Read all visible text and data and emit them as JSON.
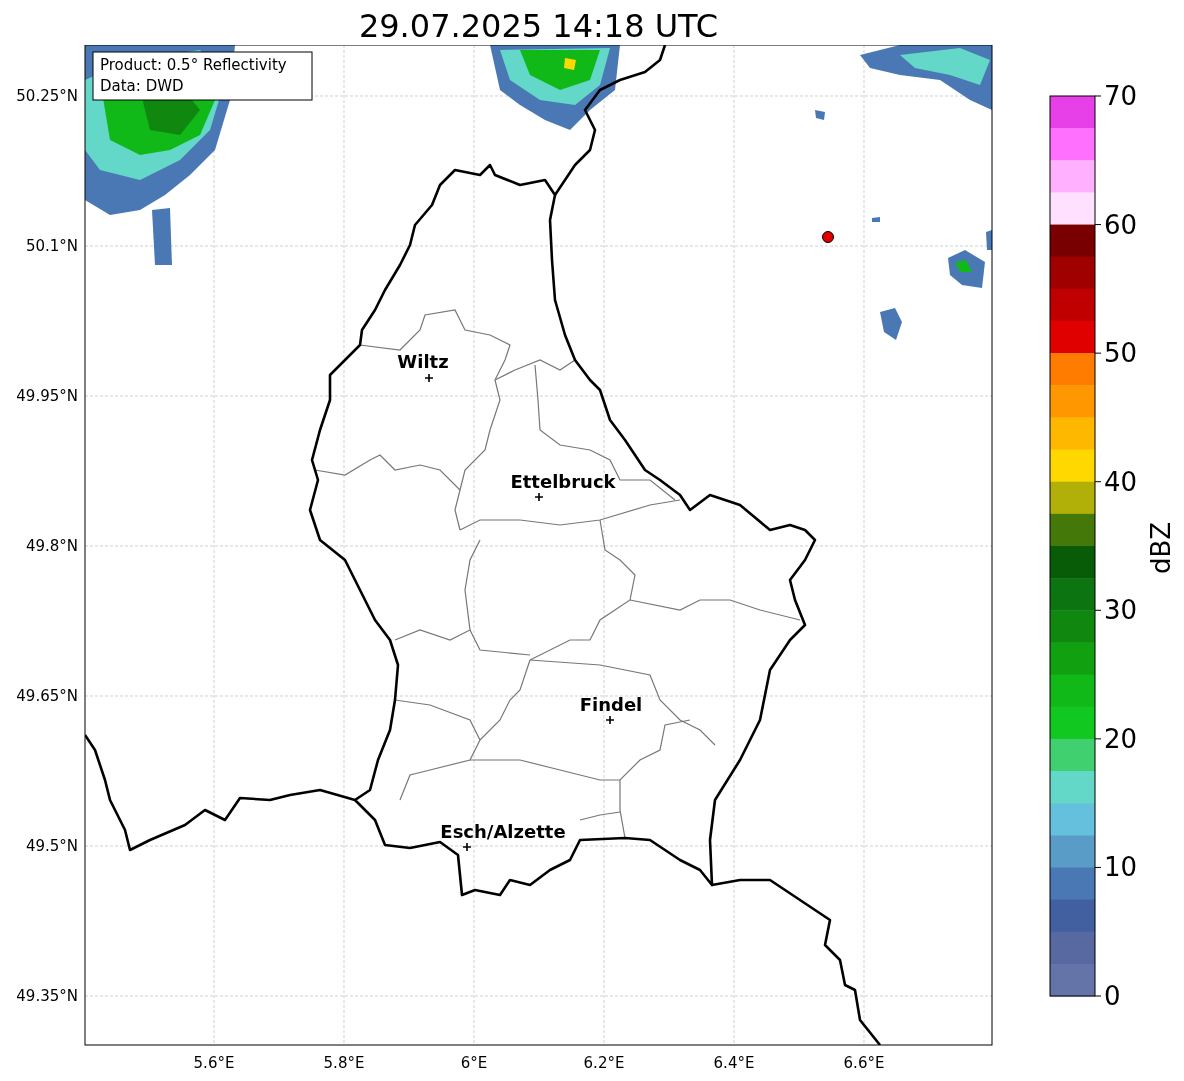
{
  "title": "29.07.2025 14:18 UTC",
  "info_box": [
    "Product: 0.5° Reflectivity",
    "Data: DWD"
  ],
  "y_ticks": [
    "50.25°N",
    "50.1°N",
    "49.95°N",
    "49.8°N",
    "49.65°N",
    "49.5°N",
    "49.35°N"
  ],
  "x_ticks": [
    "5.6°E",
    "5.8°E",
    "6°E",
    "6.2°E",
    "6.4°E",
    "6.6°E"
  ],
  "cities": [
    {
      "name": "Wiltz"
    },
    {
      "name": "Ettelbruck"
    },
    {
      "name": "Findel"
    },
    {
      "name": "Esch/Alzette"
    }
  ],
  "colorbar": {
    "label": "dBZ",
    "ticks": [
      "70",
      "60",
      "50",
      "40",
      "30",
      "20",
      "10",
      "0"
    ],
    "bins": [
      {
        "color": "#e840e8"
      },
      {
        "color": "#ff70ff"
      },
      {
        "color": "#ffb0ff"
      },
      {
        "color": "#ffe0ff"
      },
      {
        "color": "#780000"
      },
      {
        "color": "#a00000"
      },
      {
        "color": "#c00000"
      },
      {
        "color": "#e00000"
      },
      {
        "color": "#ff7c00"
      },
      {
        "color": "#ff9800"
      },
      {
        "color": "#ffb800"
      },
      {
        "color": "#ffd800"
      },
      {
        "color": "#b0b008"
      },
      {
        "color": "#447808"
      },
      {
        "color": "#085c08"
      },
      {
        "color": "#0c7410"
      },
      {
        "color": "#108810"
      },
      {
        "color": "#10a010"
      },
      {
        "color": "#10b818"
      },
      {
        "color": "#10c820"
      },
      {
        "color": "#40d070"
      },
      {
        "color": "#64d8c8"
      },
      {
        "color": "#64c0dc"
      },
      {
        "color": "#5a9cc8"
      },
      {
        "color": "#4a78b4"
      },
      {
        "color": "#4260a0"
      },
      {
        "color": "#5868a0"
      },
      {
        "color": "#6474a8"
      }
    ]
  }
}
